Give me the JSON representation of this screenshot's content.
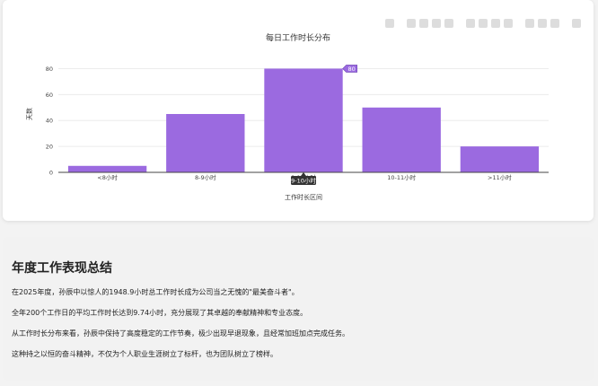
{
  "chart_data": {
    "type": "bar",
    "title": "每日工作时长分布",
    "xlabel": "工作时长区间",
    "ylabel": "天数",
    "categories": [
      "<8小时",
      "8-9小时",
      "9-10小时",
      "10-11小时",
      ">11小时"
    ],
    "values": [
      5,
      45,
      80,
      50,
      20
    ],
    "ylim": [
      0,
      90
    ],
    "yticks": [
      0,
      20,
      40,
      60,
      80
    ],
    "bar_color": "#9b6ae0",
    "grid": true,
    "hover": {
      "category": "9-10小时",
      "value": "80"
    }
  },
  "toolbar": {
    "icons": [
      "camera-icon",
      "zoom-icon",
      "pan-icon",
      "box-select-icon",
      "lasso-icon",
      "zoom-in-icon",
      "zoom-out-icon",
      "autoscale-icon",
      "reset-axes-icon",
      "spike-lines-icon",
      "hover-closest-icon",
      "hover-compare-icon",
      "plotly-logo-icon"
    ]
  },
  "summary": {
    "title": "年度工作表现总结",
    "lines": [
      "在2025年度，孙辰中以惊人的1948.9小时总工作时长成为公司当之无愧的\"最美奋斗者\"。",
      "全年200个工作日的平均工作时长达到9.74小时，充分展现了其卓越的奉献精神和专业态度。",
      "从工作时长分布来看，孙辰中保持了高度稳定的工作节奏，极少出现早退现象，且经常加班加点完成任务。",
      "这种持之以恒的奋斗精神，不仅为个人职业生涯树立了标杆，也为团队树立了榜样。"
    ]
  }
}
